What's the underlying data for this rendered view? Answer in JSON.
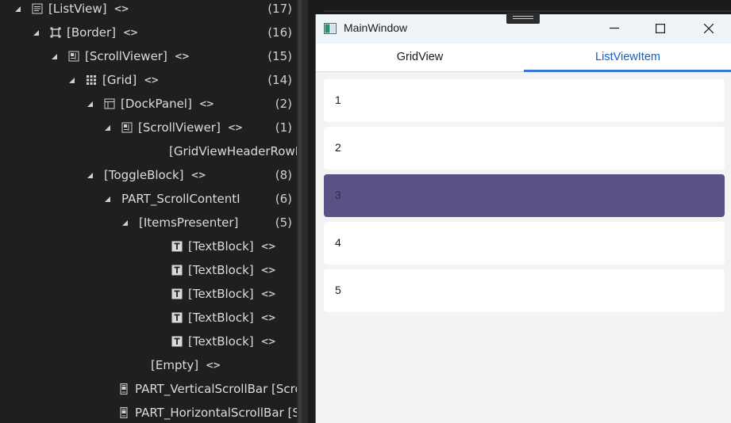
{
  "tree": {
    "rows": [
      {
        "name": "[ListView]",
        "count": "(17)",
        "expander": true,
        "icon": "listview-icon",
        "code": true
      },
      {
        "name": "[Border]",
        "count": "(16)",
        "expander": true,
        "icon": "border-icon",
        "code": true
      },
      {
        "name": "[ScrollViewer]",
        "count": "(15)",
        "expander": true,
        "icon": "scrollviewer-icon",
        "code": true
      },
      {
        "name": "[Grid]",
        "count": "(14)",
        "expander": true,
        "icon": "grid-icon",
        "code": true
      },
      {
        "name": "[DockPanel]",
        "count": "(2)",
        "expander": true,
        "icon": "dockpanel-icon",
        "code": true
      },
      {
        "name": "[ScrollViewer]",
        "count": "(1)",
        "expander": true,
        "icon": "scrollviewer-icon",
        "code": true
      },
      {
        "name": "[GridViewHeaderRowI",
        "count": "",
        "expander": false,
        "icon": "",
        "code": false
      },
      {
        "name": "[ToggleBlock]",
        "count": "(8)",
        "expander": true,
        "icon": "",
        "code": true
      },
      {
        "name": "PART_ScrollContentI",
        "count": "(6)",
        "expander": true,
        "icon": "",
        "code": false
      },
      {
        "name": "[ItemsPresenter]",
        "count": "(5)",
        "expander": true,
        "icon": "",
        "code": false
      },
      {
        "name": "[TextBlock]",
        "count": "",
        "expander": false,
        "icon": "textblock-icon",
        "code": true
      },
      {
        "name": "[TextBlock]",
        "count": "",
        "expander": false,
        "icon": "textblock-icon",
        "code": true
      },
      {
        "name": "[TextBlock]",
        "count": "",
        "expander": false,
        "icon": "textblock-icon",
        "code": true
      },
      {
        "name": "[TextBlock]",
        "count": "",
        "expander": false,
        "icon": "textblock-icon",
        "code": true
      },
      {
        "name": "[TextBlock]",
        "count": "",
        "expander": false,
        "icon": "textblock-icon",
        "code": true
      },
      {
        "name": "[Empty]",
        "count": "",
        "expander": false,
        "icon": "",
        "code": true
      },
      {
        "name": "PART_VerticalScrollBar [Scro",
        "count": "",
        "expander": false,
        "icon": "scrollbar-icon",
        "code": false
      },
      {
        "name": "PART_HorizontalScrollBar [S",
        "count": "",
        "expander": false,
        "icon": "scrollbar-icon",
        "code": false
      }
    ],
    "code_glyph": "<>"
  },
  "window": {
    "title": "MainWindow",
    "tabs": [
      {
        "label": "GridView",
        "selected": false
      },
      {
        "label": "ListViewItem",
        "selected": true
      }
    ],
    "items": [
      "1",
      "2",
      "3",
      "4",
      "5"
    ],
    "selected_item": "3",
    "accent": "#3a78d6",
    "selection_color": "#5a5185"
  }
}
